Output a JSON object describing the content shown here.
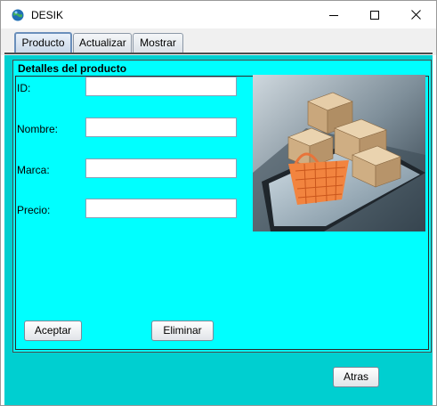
{
  "window": {
    "title": "DESIK",
    "icon": "globe-icon",
    "controls": [
      "minimize-icon",
      "maximize-icon",
      "close-icon"
    ]
  },
  "tabs": [
    {
      "label": "Producto",
      "active": true
    },
    {
      "label": "Actualizar",
      "active": false
    },
    {
      "label": "Mostrar",
      "active": false
    }
  ],
  "panel": {
    "title": "Detalles del producto",
    "fields": [
      {
        "label": "ID:",
        "value": "",
        "placeholder": ""
      },
      {
        "label": "Nombre:",
        "value": "",
        "placeholder": ""
      },
      {
        "label": "Marca:",
        "value": "",
        "placeholder": ""
      },
      {
        "label": "Precio:",
        "value": "",
        "placeholder": ""
      }
    ],
    "image": "product-boxes-shopping-basket-on-tablet",
    "buttons": {
      "accept": "Aceptar",
      "delete": "Eliminar"
    }
  },
  "footer": {
    "back": "Atras"
  },
  "colors": {
    "content_bg": "#00cfd0",
    "panel_bg": "#00ffff",
    "window_bg": "#ffffff"
  }
}
